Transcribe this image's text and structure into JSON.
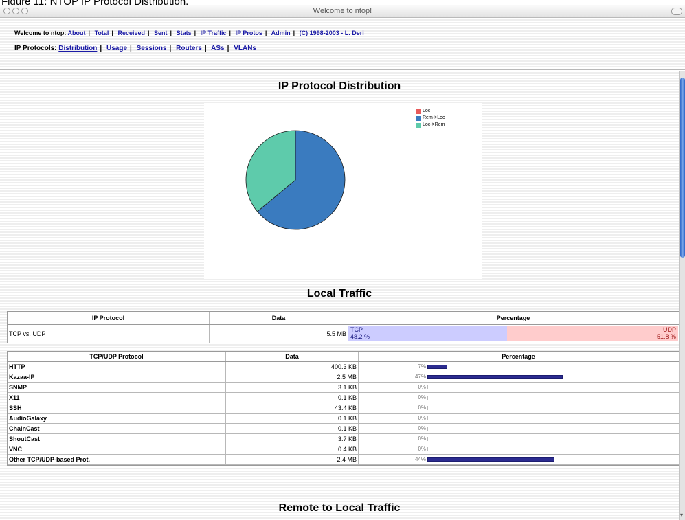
{
  "caption": "Figure 11: NTOP IP Protocol Distribution.",
  "window": {
    "title": "Welcome to ntop!"
  },
  "nav": {
    "prefix": "Welcome to ntop:",
    "links": [
      "About",
      "Total",
      "Received",
      "Sent",
      "Stats",
      "IP Traffic",
      "IP Protos",
      "Admin"
    ],
    "copyright": "(C) 1998-2003 - L. Deri",
    "protocols_label": "IP Protocols:",
    "protocol_links": [
      "Distribution",
      "Usage",
      "Sessions",
      "Routers",
      "ASs",
      "VLANs"
    ],
    "active": "Distribution"
  },
  "main": {
    "title": "IP Protocol Distribution",
    "chart_data": {
      "type": "pie",
      "title": "",
      "legend": [
        "Loc",
        "Rem->Loc",
        "Loc->Rem"
      ],
      "legend_position": "top-right",
      "values": [
        0,
        64,
        36
      ],
      "colors": [
        "#e85a5a",
        "#3a7bbf",
        "#5ecbab"
      ]
    },
    "local_traffic_title": "Local Traffic",
    "tcp_udp_table": {
      "headers": [
        "IP Protocol",
        "Data",
        "Percentage"
      ],
      "row": {
        "protocol": "TCP vs. UDP",
        "data": "5.5 MB",
        "tcp_label": "TCP",
        "tcp_pct": "48.2 %",
        "udp_label": "UDP",
        "udp_pct": "51.8 %",
        "tcp_fraction": 0.482
      },
      "tcp_color": "#ccccff",
      "udp_color": "#ffcccc"
    },
    "protocol_table": {
      "headers": [
        "TCP/UDP Protocol",
        "Data",
        "Percentage"
      ],
      "rows": [
        {
          "name": "HTTP",
          "data": "400.3 KB",
          "pct": "7%",
          "fraction": 0.07
        },
        {
          "name": "Kazaa-IP",
          "data": "2.5 MB",
          "pct": "47%",
          "fraction": 0.47
        },
        {
          "name": "SNMP",
          "data": "3.1 KB",
          "pct": "0%",
          "fraction": 0
        },
        {
          "name": "X11",
          "data": "0.1 KB",
          "pct": "0%",
          "fraction": 0
        },
        {
          "name": "SSH",
          "data": "43.4 KB",
          "pct": "0%",
          "fraction": 0
        },
        {
          "name": "AudioGalaxy",
          "data": "0.1 KB",
          "pct": "0%",
          "fraction": 0
        },
        {
          "name": "ChainCast",
          "data": "0.1 KB",
          "pct": "0%",
          "fraction": 0
        },
        {
          "name": "ShoutCast",
          "data": "3.7 KB",
          "pct": "0%",
          "fraction": 0
        },
        {
          "name": "VNC",
          "data": "0.4 KB",
          "pct": "0%",
          "fraction": 0
        },
        {
          "name": "Other TCP/UDP-based Prot.",
          "data": "2.4 MB",
          "pct": "44%",
          "fraction": 0.44
        }
      ]
    },
    "remote_title": "Remote to Local Traffic"
  }
}
